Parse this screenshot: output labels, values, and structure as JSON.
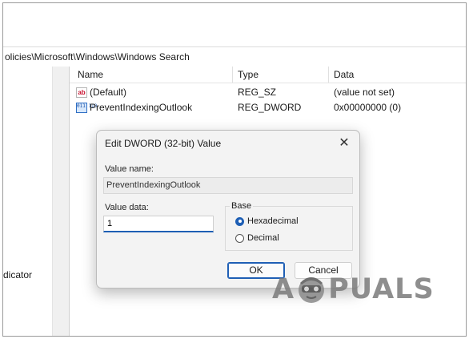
{
  "address_path": "olicies\\Microsoft\\Windows\\Windows Search",
  "tree": {
    "partial_item": "dicator"
  },
  "list": {
    "columns": {
      "name": "Name",
      "type": "Type",
      "data": "Data"
    },
    "rows": [
      {
        "icon": "string-value-icon",
        "icon_text": "ab",
        "name": "(Default)",
        "type": "REG_SZ",
        "data": "(value not set)"
      },
      {
        "icon": "dword-value-icon",
        "icon_text": "011 110",
        "name": "PreventIndexingOutlook",
        "type": "REG_DWORD",
        "data": "0x00000000 (0)"
      }
    ]
  },
  "dialog": {
    "title": "Edit DWORD (32-bit) Value",
    "close_glyph": "✕",
    "value_name_label": "Value name:",
    "value_name": "PreventIndexingOutlook",
    "value_data_label": "Value data:",
    "value_data": "1",
    "base_label": "Base",
    "radios": {
      "hex": {
        "label": "Hexadecimal",
        "checked": true
      },
      "dec": {
        "label": "Decimal",
        "checked": false
      }
    },
    "ok_label": "OK",
    "cancel_label": "Cancel"
  },
  "watermark": {
    "left": "A",
    "right": "PUALS"
  },
  "colors": {
    "accent": "#1f5fb5",
    "dialog_bg": "#f3f3f3",
    "watermark": "#7b7b7b"
  }
}
